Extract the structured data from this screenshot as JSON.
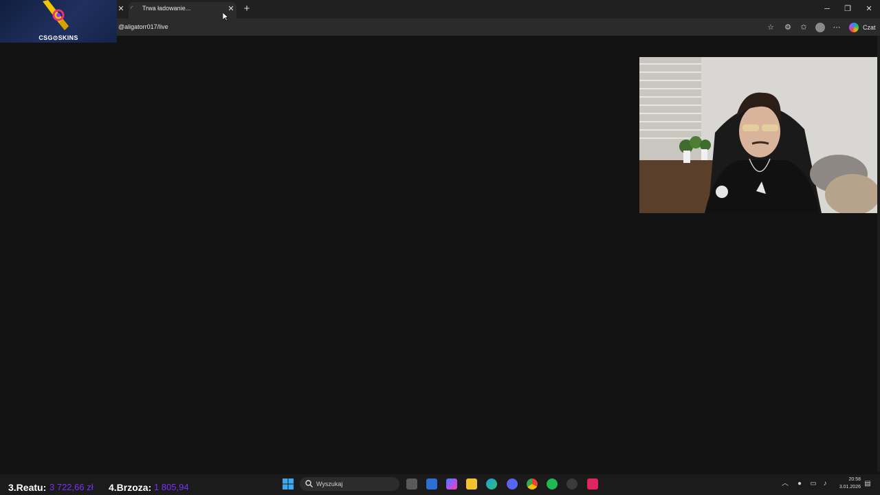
{
  "browser": {
    "tab": {
      "title": "Trwa ładowanie...",
      "close": "✕"
    },
    "prev_tab_close": "✕",
    "new_tab": "+",
    "window_controls": {
      "minimize": "─",
      "maximize": "❐",
      "close": "✕"
    },
    "address_url": "@aligatorr017/live",
    "toolbar_icons": [
      "star-icon",
      "extensions-icon",
      "favorites-icon",
      "profile-avatar-icon",
      "more-icon",
      "copilot-icon"
    ],
    "chat_label": "Czat"
  },
  "overlay": {
    "logo_text": "CSG⊙SKINS"
  },
  "leaderboard": [
    {
      "rank": "3.Reatu:",
      "value": "3 722,66 zł"
    },
    {
      "rank": "4.Brzoza:",
      "value": "1 805,94"
    }
  ],
  "taskbar": {
    "search_placeholder": "Wyszukaj",
    "apps": [
      "task-view-icon",
      "store-icon",
      "copilot-app-icon",
      "file-explorer-icon",
      "edge-icon",
      "discord-icon",
      "chrome-icon",
      "spotify-icon",
      "steam-icon",
      "tiktok-icon"
    ],
    "clock_time": "20:58",
    "clock_date": "3.01.2026"
  },
  "colors": {
    "leaderboard_value": "#7b2fff",
    "page_bg": "#131313"
  }
}
